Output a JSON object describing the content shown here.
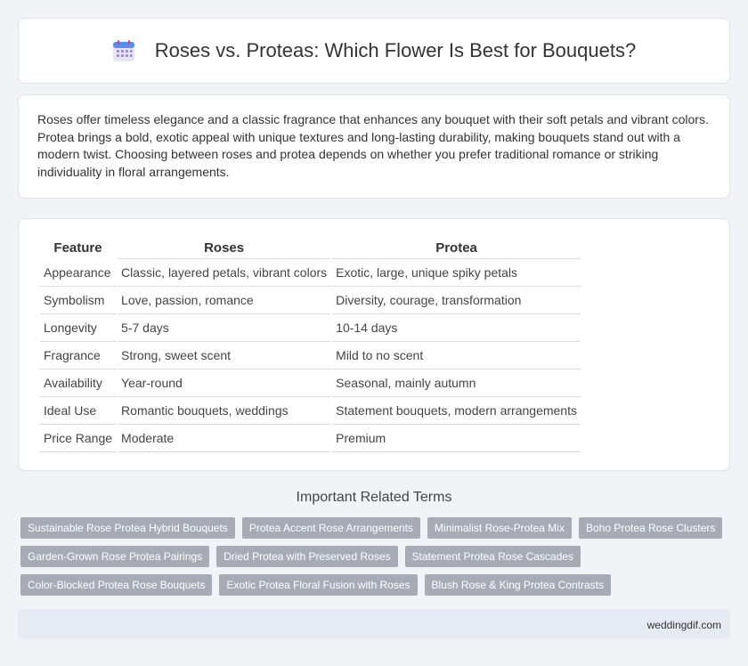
{
  "header": {
    "title": "Roses vs. Proteas: Which Flower Is Best for Bouquets?",
    "icon": "calendar-icon"
  },
  "intro": {
    "text": "Roses offer timeless elegance and a classic fragrance that enhances any bouquet with their soft petals and vibrant colors. Protea brings a bold, exotic appeal with unique textures and long-lasting durability, making bouquets stand out with a modern twist. Choosing between roses and protea depends on whether you prefer traditional romance or striking individuality in floral arrangements."
  },
  "table": {
    "headers": [
      "Feature",
      "Roses",
      "Protea"
    ],
    "rows": [
      [
        "Appearance",
        "Classic, layered petals, vibrant colors",
        "Exotic, large, unique spiky petals"
      ],
      [
        "Symbolism",
        "Love, passion, romance",
        "Diversity, courage, transformation"
      ],
      [
        "Longevity",
        "5-7 days",
        "10-14 days"
      ],
      [
        "Fragrance",
        "Strong, sweet scent",
        "Mild to no scent"
      ],
      [
        "Availability",
        "Year-round",
        "Seasonal, mainly autumn"
      ],
      [
        "Ideal Use",
        "Romantic bouquets, weddings",
        "Statement bouquets, modern arrangements"
      ],
      [
        "Price Range",
        "Moderate",
        "Premium"
      ]
    ]
  },
  "related": {
    "title": "Important Related Terms",
    "tags": [
      [
        "Sustainable Rose Protea Hybrid Bouquets",
        "Protea Accent Rose Arrangements",
        "Minimalist Rose-Protea Mix",
        "Boho Protea Rose Clusters"
      ],
      [
        "Garden-Grown Rose Protea Pairings",
        "Dried Protea with Preserved Roses",
        "Statement Protea Rose Cascades"
      ],
      [
        "Color-Blocked Protea Rose Bouquets",
        "Exotic Protea Floral Fusion with Roses",
        "Blush Rose & King Protea Contrasts"
      ]
    ]
  },
  "footer": {
    "site": "weddingdif.com"
  },
  "colors": {
    "tag_bg": "#a6abb6",
    "page_bg": "#f2f3f7",
    "footer_bg": "#e6eaf3"
  }
}
